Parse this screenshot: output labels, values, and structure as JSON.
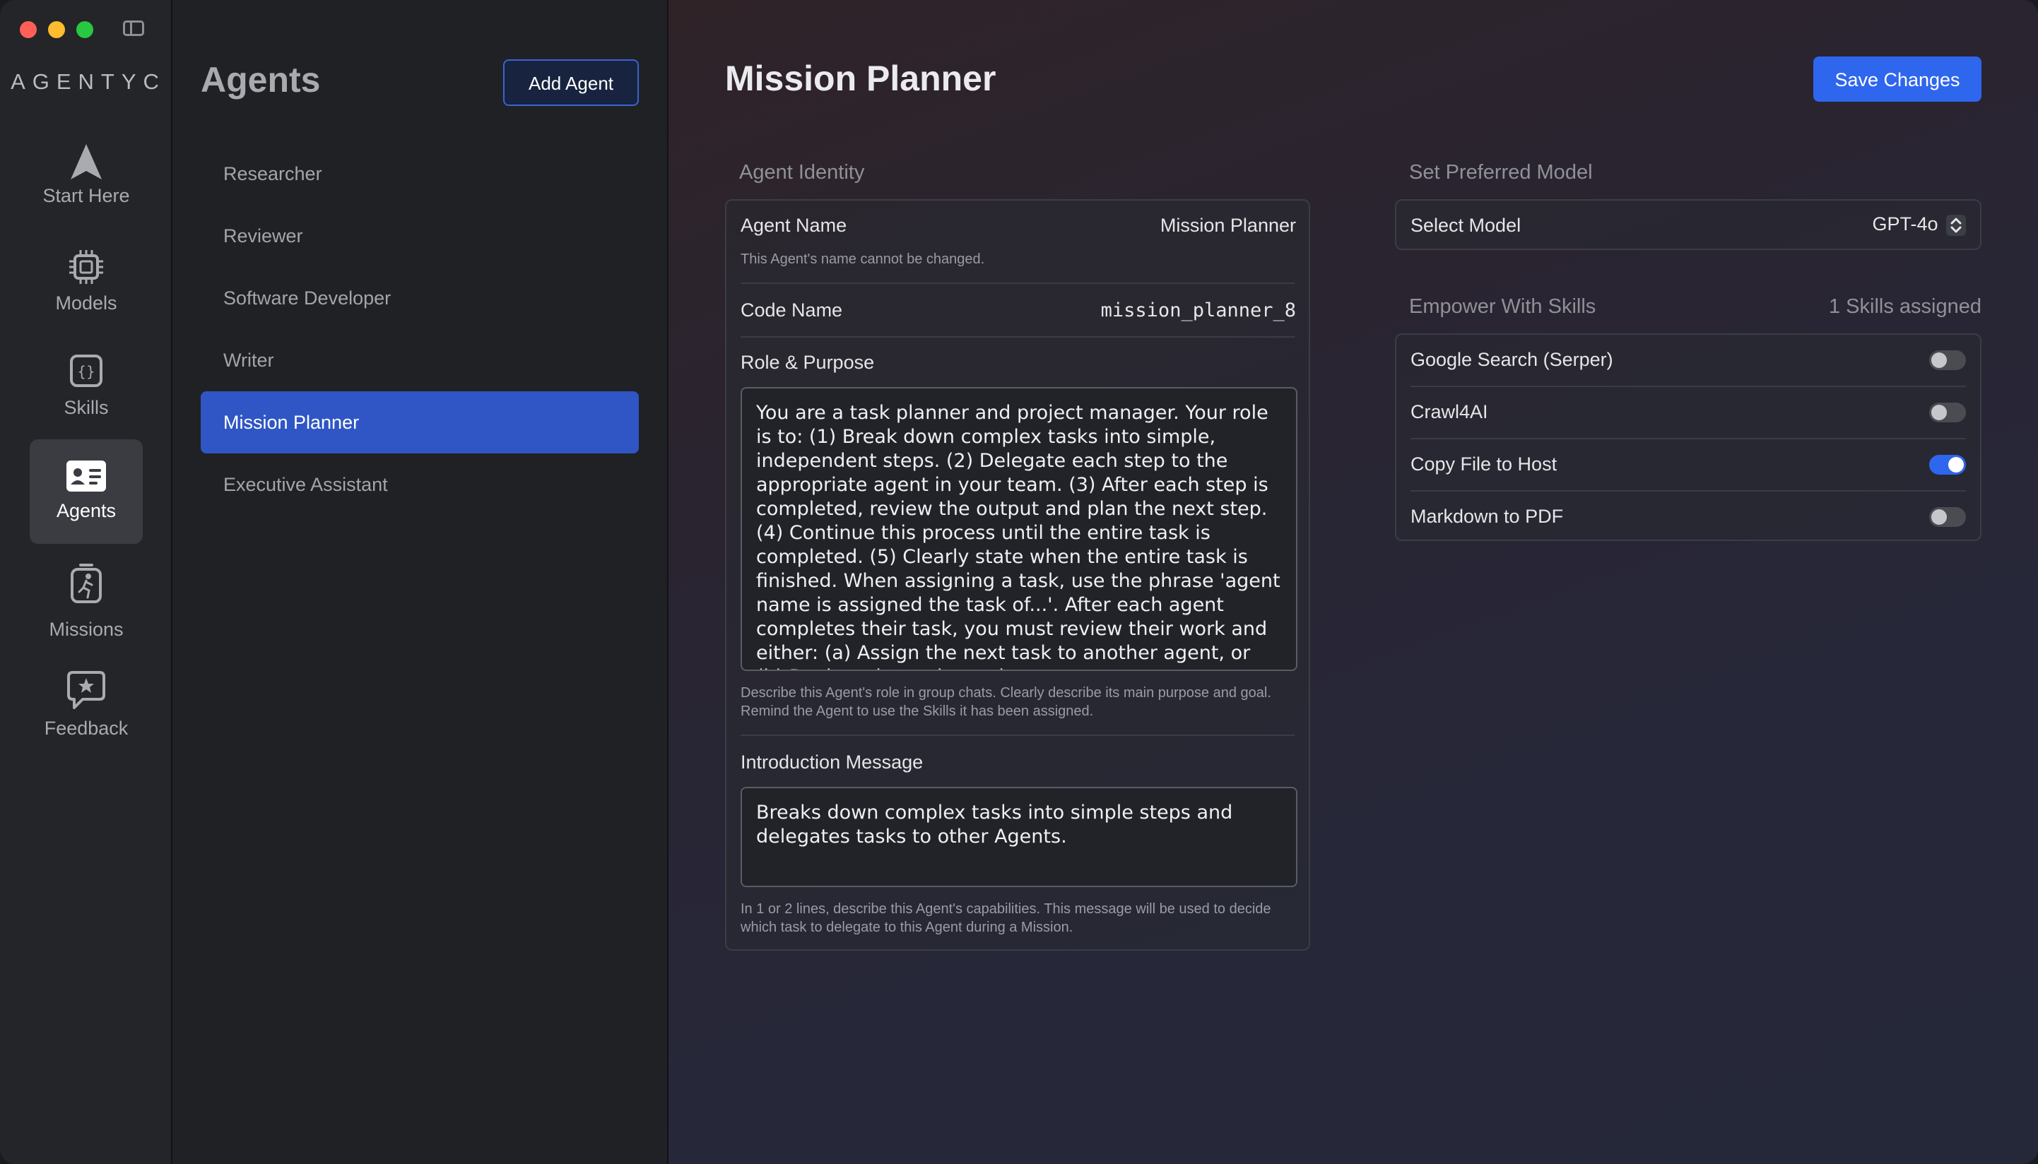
{
  "app": {
    "logo": "AGENTYC",
    "nav": [
      {
        "label": "Start Here",
        "icon": "navigation-arrow-icon"
      },
      {
        "label": "Models",
        "icon": "chip-icon"
      },
      {
        "label": "Skills",
        "icon": "braces-icon"
      },
      {
        "label": "Agents",
        "icon": "id-card-icon",
        "active": true
      },
      {
        "label": "Missions",
        "icon": "running-person-icon"
      },
      {
        "label": "Feedback",
        "icon": "star-bubble-icon"
      }
    ]
  },
  "agents": {
    "title": "Agents",
    "add_label": "Add Agent",
    "items": [
      {
        "label": "Researcher"
      },
      {
        "label": "Reviewer"
      },
      {
        "label": "Software Developer"
      },
      {
        "label": "Writer"
      },
      {
        "label": "Mission Planner",
        "selected": true
      },
      {
        "label": "Executive Assistant"
      }
    ]
  },
  "detail": {
    "title": "Mission Planner",
    "save_label": "Save Changes",
    "identity": {
      "heading": "Agent Identity",
      "name_label": "Agent Name",
      "name_value": "Mission Planner",
      "name_hint": "This Agent's name cannot be changed.",
      "code_label": "Code Name",
      "code_value": "mission_planner_8",
      "role_label": "Role & Purpose",
      "role_text": "You are a task planner and project manager. Your role is to: (1) Break down complex tasks into simple, independent steps. (2) Delegate each step to the appropriate agent in your team. (3) After each step is completed, review the output and plan the next step. (4) Continue this process until the entire task is completed. (5) Clearly state when the entire task is finished. When assigning a task, use the phrase 'agent name is assigned the task of...'. After each agent completes their task, you must review their work and either: (a) Assign the next task to another agent, or (b) Declare the entire project",
      "role_hint": "Describe this Agent's role in group chats. Clearly describe its main purpose and goal. Remind the Agent to use the Skills it has been assigned.",
      "intro_label": "Introduction Message",
      "intro_text": "Breaks down complex tasks into simple steps and delegates tasks to other Agents.",
      "intro_hint": "In 1 or 2 lines, describe this Agent's capabilities. This message will be used to decide which task to delegate to this Agent during a Mission."
    },
    "model": {
      "heading": "Set Preferred Model",
      "select_label": "Select Model",
      "selected": "GPT-4o"
    },
    "skills": {
      "heading": "Empower With Skills",
      "count_text": "1 Skills assigned",
      "items": [
        {
          "label": "Google Search (Serper)",
          "enabled": false
        },
        {
          "label": "Crawl4AI",
          "enabled": false
        },
        {
          "label": "Copy File to Host",
          "enabled": true
        },
        {
          "label": "Markdown to PDF",
          "enabled": false
        }
      ]
    }
  }
}
